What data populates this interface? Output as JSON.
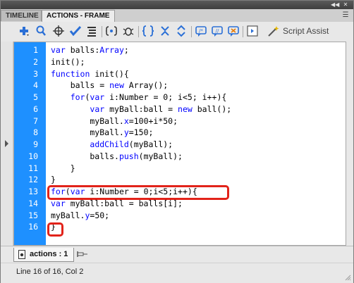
{
  "tabs": [
    {
      "label": "TIMELINE",
      "active": false
    },
    {
      "label": "ACTIONS - FRAME",
      "active": true
    }
  ],
  "toolbar": {
    "buttons": [
      {
        "name": "add-statement-icon"
      },
      {
        "name": "find-icon"
      },
      {
        "name": "insert-target-path-icon"
      },
      {
        "name": "check-syntax-icon"
      },
      {
        "name": "auto-format-icon"
      },
      {
        "name": "show-code-hint-icon"
      },
      {
        "name": "debug-options-icon"
      },
      {
        "name": "collapse-between-braces-icon"
      },
      {
        "name": "collapse-selection-icon"
      },
      {
        "name": "expand-all-icon"
      },
      {
        "name": "apply-block-comment-icon"
      },
      {
        "name": "apply-line-comment-icon"
      },
      {
        "name": "remove-comment-icon"
      },
      {
        "name": "show-hide-toolbox-icon"
      }
    ],
    "script_assist_label": "Script Assist"
  },
  "code_lines": [
    {
      "num": "1",
      "text": "var balls:Array;"
    },
    {
      "num": "2",
      "text": "init();"
    },
    {
      "num": "3",
      "text": "function init(){"
    },
    {
      "num": "4",
      "text": "    balls = new Array();"
    },
    {
      "num": "5",
      "text": "    for(var i:Number = 0; i<5; i++){"
    },
    {
      "num": "6",
      "text": "        var myBall:ball = new ball();"
    },
    {
      "num": "7",
      "text": "        myBall.x=100+i*50;"
    },
    {
      "num": "8",
      "text": "        myBall.y=150;"
    },
    {
      "num": "9",
      "text": "        addChild(myBall);"
    },
    {
      "num": "10",
      "text": "        balls.push(myBall);"
    },
    {
      "num": "11",
      "text": "    }"
    },
    {
      "num": "12",
      "text": "}"
    },
    {
      "num": "13",
      "text": "for(var i:Number = 0;i<5;i++){"
    },
    {
      "num": "14",
      "text": "var myBall:ball = balls[i];"
    },
    {
      "num": "15",
      "text": "myBall.y=50;"
    },
    {
      "num": "16",
      "text": "}"
    }
  ],
  "highlighted_lines": [
    "13",
    "16"
  ],
  "bottom_tab": {
    "label": "actions : 1"
  },
  "status": {
    "text": "Line 16 of 16, Col 2"
  },
  "colors": {
    "gutter": "#1e90ff",
    "keyword": "#0000ff",
    "highlight_border": "#e2231a"
  }
}
